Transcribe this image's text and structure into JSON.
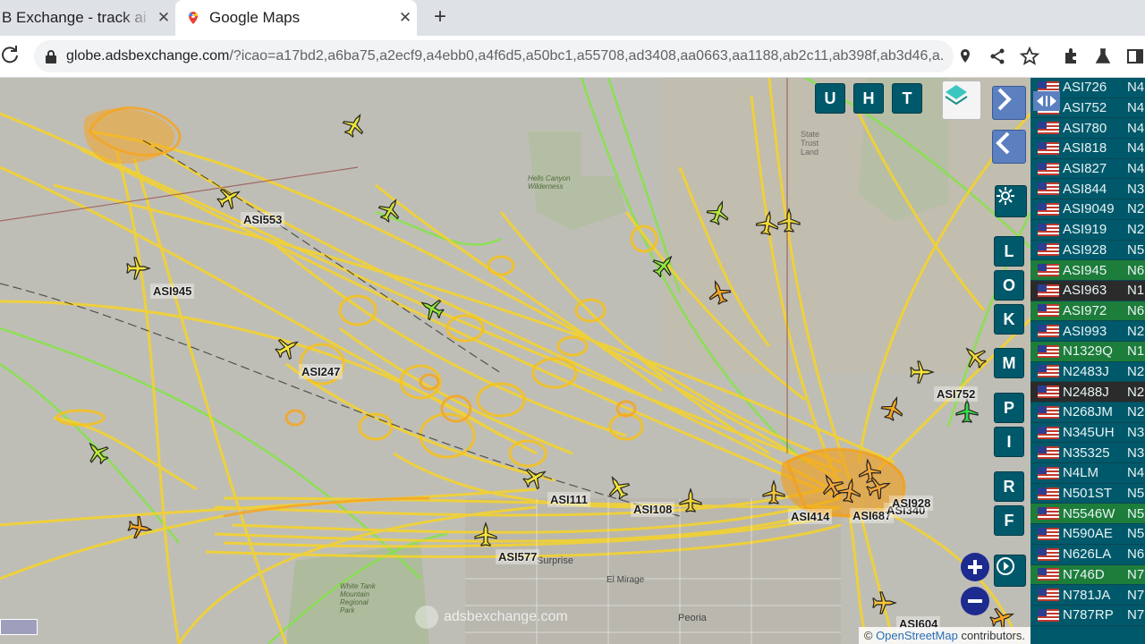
{
  "browser": {
    "tabs": [
      {
        "title": "B Exchange - track ai",
        "close": "✕"
      },
      {
        "title": "Google Maps",
        "close": "✕"
      }
    ],
    "new_tab": "+",
    "url_host": "globe.adsbexchange.com",
    "url_path": "/?icao=a17bd2,a6ba75,a2ecf9,a4ebb0,a4f6d5,a50bc1,a55708,ad3408,aa0663,aa1188,ab2c11,ab398f,ab3d46,a..."
  },
  "map": {
    "top_buttons": [
      "U",
      "H",
      "T"
    ],
    "side_buttons": [
      "L",
      "O",
      "K",
      "M",
      "P",
      "I",
      "R",
      "F"
    ],
    "labels": {
      "l553": "ASI553",
      "l945": "ASI945",
      "l247": "ASI247",
      "l111": "ASI111",
      "l108": "ASI108",
      "l414": "ASI414",
      "l687": "ASI687",
      "l340": "ASI340",
      "l928": "ASI928",
      "l577": "ASI577",
      "l752": "ASI752",
      "l604": "ASI604"
    },
    "places": {
      "state_trust": "State Trust Land",
      "hells_canyon": "Hells Canyon Wilderness",
      "white_tank": "White Tank Mountain Regional Park",
      "surprise": "Surprise",
      "el_mirage": "El Mirage",
      "peoria": "Peoria"
    },
    "watermark": "adsbexchange.com",
    "attribution_prefix": "© ",
    "attribution_link": "OpenStreetMap",
    "attribution_suffix": " contributors.",
    "colors": {
      "track_yellow": "#f7d428",
      "track_orange": "#f5a623",
      "track_green": "#7be03a",
      "panel": "#00596b"
    }
  },
  "aircraft_list": [
    {
      "reg": "ASI726",
      "n": "N4",
      "style": "normal"
    },
    {
      "reg": "ASI752",
      "n": "N4",
      "style": "normal"
    },
    {
      "reg": "ASI780",
      "n": "N4",
      "style": "normal"
    },
    {
      "reg": "ASI818",
      "n": "N4",
      "style": "normal"
    },
    {
      "reg": "ASI827",
      "n": "N4",
      "style": "normal"
    },
    {
      "reg": "ASI844",
      "n": "N3",
      "style": "normal"
    },
    {
      "reg": "ASI9049",
      "n": "N2",
      "style": "normal"
    },
    {
      "reg": "ASI919",
      "n": "N2",
      "style": "normal"
    },
    {
      "reg": "ASI928",
      "n": "N5",
      "style": "normal"
    },
    {
      "reg": "ASI945",
      "n": "N6",
      "style": "green"
    },
    {
      "reg": "ASI963",
      "n": "N1",
      "style": "dark"
    },
    {
      "reg": "ASI972",
      "n": "N6",
      "style": "green"
    },
    {
      "reg": "ASI993",
      "n": "N2",
      "style": "normal"
    },
    {
      "reg": "N1329Q",
      "n": "N1",
      "style": "green"
    },
    {
      "reg": "N2483J",
      "n": "N2",
      "style": "normal"
    },
    {
      "reg": "N2488J",
      "n": "N2",
      "style": "dark"
    },
    {
      "reg": "N268JM",
      "n": "N2",
      "style": "normal"
    },
    {
      "reg": "N345UH",
      "n": "N3",
      "style": "normal"
    },
    {
      "reg": "N35325",
      "n": "N3",
      "style": "normal"
    },
    {
      "reg": "N4LM",
      "n": "N4",
      "style": "normal"
    },
    {
      "reg": "N501ST",
      "n": "N5",
      "style": "normal"
    },
    {
      "reg": "N5546W",
      "n": "N5",
      "style": "green"
    },
    {
      "reg": "N590AE",
      "n": "N5",
      "style": "normal"
    },
    {
      "reg": "N626LA",
      "n": "N6",
      "style": "normal"
    },
    {
      "reg": "N746D",
      "n": "N7",
      "style": "green"
    },
    {
      "reg": "N781JA",
      "n": "N7",
      "style": "normal"
    },
    {
      "reg": "N787RP",
      "n": "N7",
      "style": "normal"
    }
  ]
}
